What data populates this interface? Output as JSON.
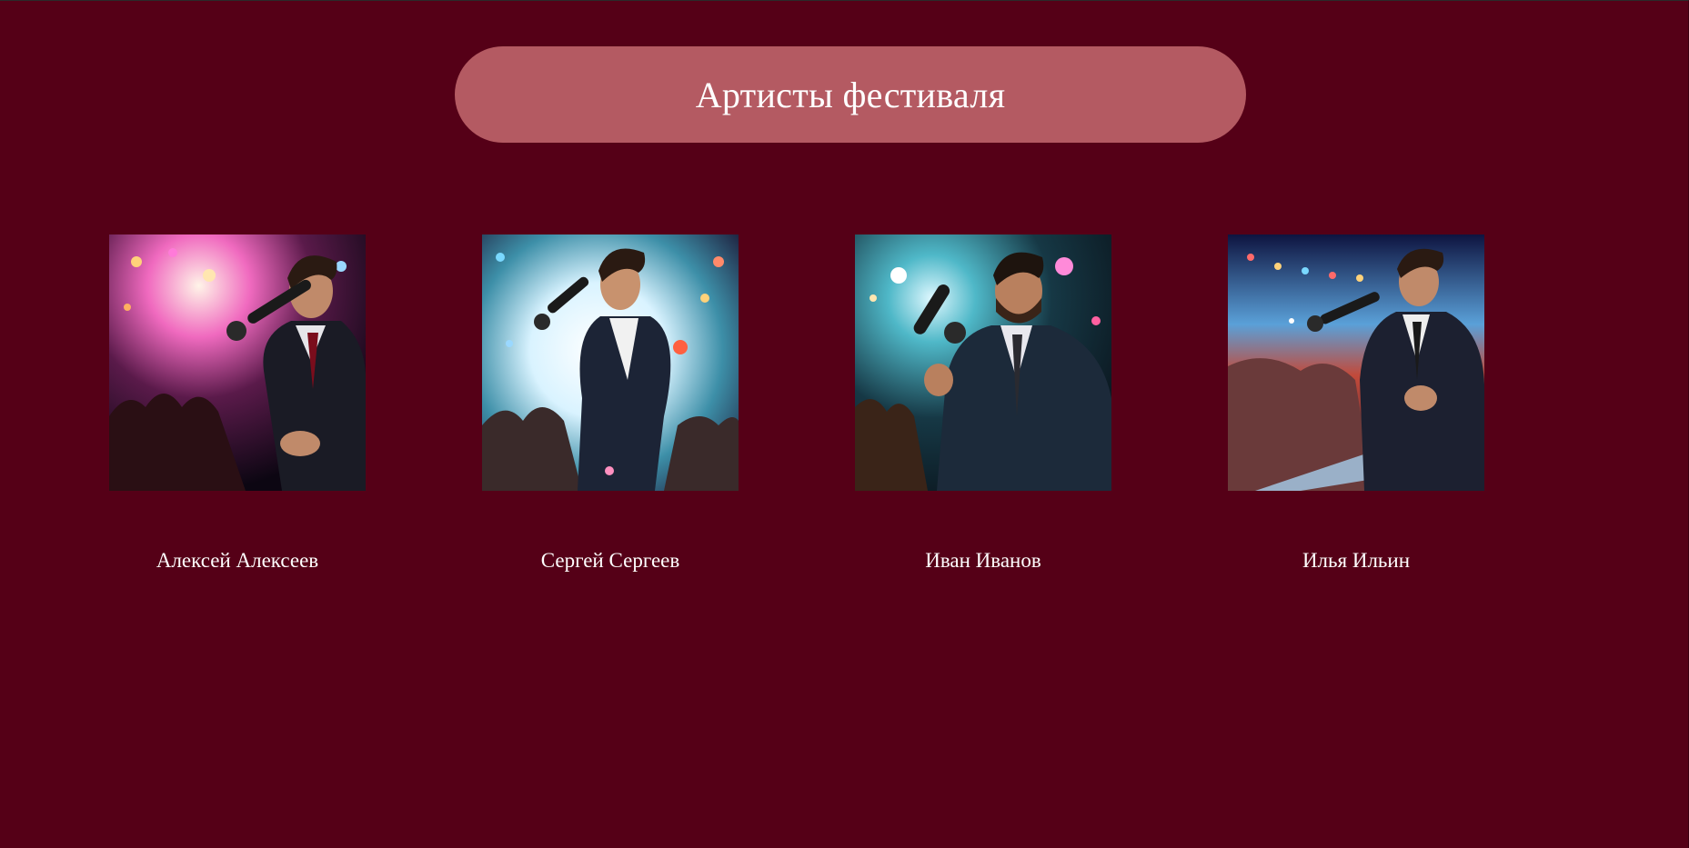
{
  "page": {
    "title": "Артисты фестиваля"
  },
  "artists": [
    {
      "name": "Алексей Алексеев",
      "photo_icon": "singer-photo"
    },
    {
      "name": "Сергей Сергеев",
      "photo_icon": "singer-photo"
    },
    {
      "name": "Иван Иванов",
      "photo_icon": "singer-photo"
    },
    {
      "name": "Илья Ильин",
      "photo_icon": "singer-photo"
    }
  ],
  "colors": {
    "background": "#550017",
    "header_pill": "#b45a62",
    "text": "#ffffff"
  }
}
